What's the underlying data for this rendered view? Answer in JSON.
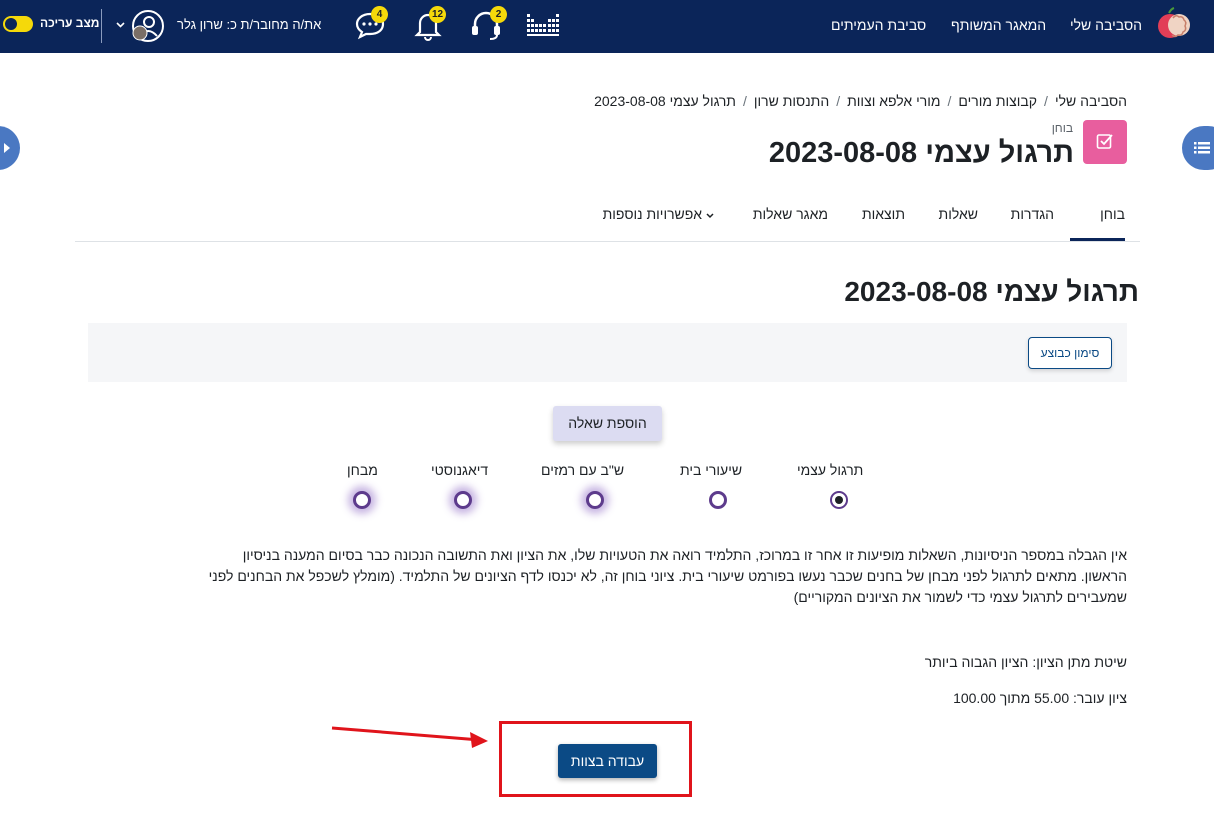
{
  "navbar": {
    "brand": "הסביבה שלי",
    "shared_repo": "המאגר המשותף",
    "peer_env": "סביבת העמיתים",
    "user_label": "את/ה מחובר/ת כ: שרון גלר",
    "edit_mode": "מצב עריכה",
    "badges": {
      "messages": "4",
      "notifications": "12",
      "support": "2"
    }
  },
  "breadcrumb": [
    "הסביבה שלי",
    "קבוצות מורים",
    "מורי אלפא וצוות",
    "התנסות שרון",
    "תרגול עצמי 2023-08-08"
  ],
  "header": {
    "module_type": "בוחן",
    "title": "תרגול עצמי 2023-08-08"
  },
  "tabs": [
    "בוחן",
    "הגדרות",
    "שאלות",
    "תוצאות",
    "מאגר שאלות",
    "אפשרויות נוספות"
  ],
  "main": {
    "heading": "תרגול עצמי 2023-08-08",
    "mark_done": "סימון כבוצע",
    "add_question": "הוספת שאלה",
    "quiz_types": [
      "תרגול עצמי",
      "שיעורי בית",
      "ש\"ב עם רמזים",
      "דיאגנוסטי",
      "מבחן"
    ],
    "description": "אין הגבלה במספר הניסיונות, השאלות מופיעות זו אחר זו במרוכז, התלמיד רואה את הטעויות שלו, את הציון ואת התשובה הנכונה כבר בסיום המענה בניסיון הראשון. מתאים לתרגול לפני מבחן של בחנים שכבר נעשו בפורמט שיעורי בית. ציוני בוחן זה, לא יכנסו לדף הציונים של התלמיד. (מומלץ לשכפל את הבחנים לפני שמעבירים לתרגול עצמי כדי לשמור את הציונים המקוריים)",
    "grade_method": "שיטת מתן הציון: הציון הגבוה ביותר",
    "pass_grade": "ציון עובר: 55.00 מתוך 100.00",
    "teams_button": "עבודה בצוות"
  },
  "colors": {
    "navbar": "#0b2559",
    "accent": "#0b4a85",
    "badge": "#f5d90a",
    "highlight": "#e0141b"
  }
}
